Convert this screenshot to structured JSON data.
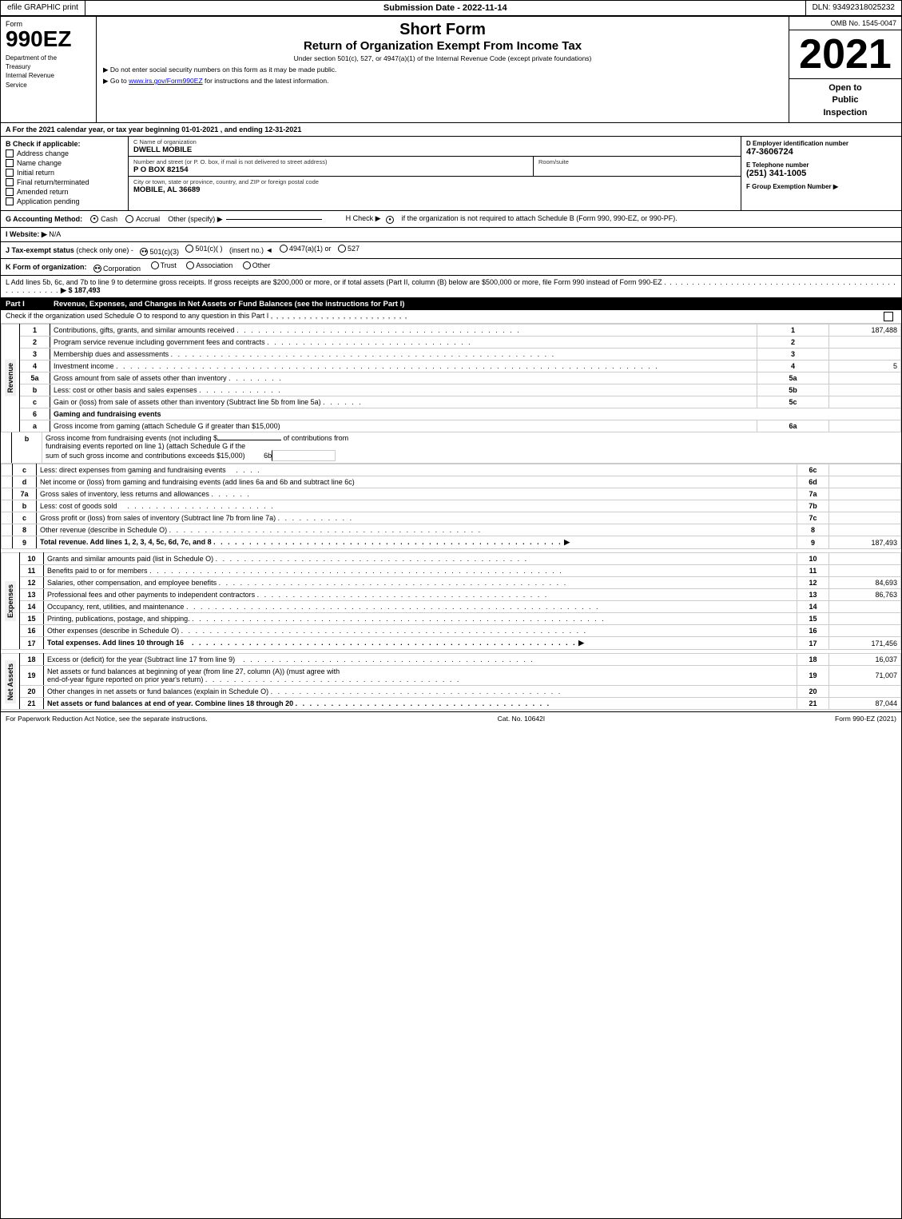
{
  "topbar": {
    "left": "efile GRAPHIC print",
    "mid": "Submission Date - 2022-11-14",
    "right": "DLN: 93492318025232"
  },
  "header": {
    "form_label": "Form",
    "form_number": "990EZ",
    "dept_line1": "Department of the",
    "dept_line2": "Treasury",
    "dept_line3": "Internal Revenue",
    "dept_line4": "Service",
    "title_main": "Short Form",
    "title_sub": "Return of Organization Exempt From Income Tax",
    "under_section": "Under section 501(c), 527, or 4947(a)(1) of the Internal Revenue Code (except private foundations)",
    "notice": "▶ Do not enter social security numbers on this form as it may be made public.",
    "goto": "▶ Go to www.irs.gov/Form990EZ for instructions and the latest information.",
    "omb": "OMB No. 1545-0047",
    "year": "2021",
    "open_public": "Open to Public Inspection"
  },
  "section_a": {
    "text": "A For the 2021 calendar year, or tax year beginning 01-01-2021 , and ending 12-31-2021"
  },
  "check_applicable": {
    "label": "B Check if applicable:",
    "items": [
      {
        "id": "address_change",
        "label": "Address change",
        "checked": false
      },
      {
        "id": "name_change",
        "label": "Name change",
        "checked": false
      },
      {
        "id": "initial_return",
        "label": "Initial return",
        "checked": false
      },
      {
        "id": "final_return",
        "label": "Final return/terminated",
        "checked": false
      },
      {
        "id": "amended_return",
        "label": "Amended return",
        "checked": false
      },
      {
        "id": "application_pending",
        "label": "Application pending",
        "checked": false
      }
    ]
  },
  "org": {
    "name_label": "C Name of organization",
    "name_value": "DWELL MOBILE",
    "address_label": "Number and street (or P. O. box, if mail is not delivered to street address)",
    "address_value": "P O BOX 82154",
    "room_label": "Room/suite",
    "room_value": "",
    "city_label": "City or town, state or province, country, and ZIP or foreign postal code",
    "city_value": "MOBILE, AL  36689"
  },
  "employer_id": {
    "label": "D Employer identification number",
    "value": "47-3606724"
  },
  "telephone": {
    "label": "E Telephone number",
    "value": "(251) 341-1005"
  },
  "group_exemption": {
    "label": "F Group Exemption Number",
    "arrow": "▶"
  },
  "accounting": {
    "label": "G Accounting Method:",
    "cash_label": "Cash",
    "cash_checked": true,
    "accrual_label": "Accrual",
    "accrual_checked": false,
    "other_label": "Other (specify) ▶",
    "other_value": "",
    "h_label": "H Check ▶",
    "h_checked": true,
    "h_text": "if the organization is not required to attach Schedule B (Form 990, 990-EZ, or 990-PF)."
  },
  "website": {
    "label": "I Website: ▶",
    "value": "N/A"
  },
  "tax_exempt": {
    "label": "J Tax-exempt status",
    "note": "(check only one) -",
    "options": [
      {
        "label": "501(c)(3)",
        "checked": true
      },
      {
        "label": "501(c)(  )",
        "checked": false
      },
      {
        "label": "(insert no.)",
        "checked": false
      },
      {
        "label": "4947(a)(1) or",
        "checked": false
      },
      {
        "label": "527",
        "checked": false
      }
    ]
  },
  "form_org": {
    "label": "K Form of organization:",
    "options": [
      {
        "label": "Corporation",
        "checked": true
      },
      {
        "label": "Trust",
        "checked": false
      },
      {
        "label": "Association",
        "checked": false
      },
      {
        "label": "Other",
        "checked": false
      }
    ]
  },
  "add_lines": {
    "label": "L Add lines 5b, 6c, and 7b to line 9 to determine gross receipts. If gross receipts are $200,000 or more, or if total assets (Part II, column (B) below are $500,000 or more, file Form 990 instead of Form 990-EZ",
    "dots": ". . . . . . . . . . . . . . . . . . . . . . . . . . . . . . . . . . . . . . . . . . . . . . . . . . . .",
    "arrow": "▶",
    "value": "$ 187,493"
  },
  "part1": {
    "header_left": "Part I",
    "header_right": "Revenue, Expenses, and Changes in Net Assets or Fund Balances (see the instructions for Part I)",
    "check_line": "Check if the organization used Schedule O to respond to any question in this Part I",
    "dots": ". . . . . . . . . . . . . . . . . . . . . . . . .",
    "rows": [
      {
        "num": "1",
        "desc": "Contributions, gifts, grants, and similar amounts received",
        "dots": ". . . . . . . . . . . . . . . . . . . . . . . . . . . . . . . . . . . . . . . .",
        "line": "1",
        "value": "187,488"
      },
      {
        "num": "2",
        "desc": "Program service revenue including government fees and contracts",
        "dots": ". . . . . . . . . . . . . . . . . . . . . . . . . . . . .",
        "line": "2",
        "value": ""
      },
      {
        "num": "3",
        "desc": "Membership dues and assessments",
        "dots": ". . . . . . . . . . . . . . . . . . . . . . . . . . . . . . . . . . . . . . . . . . . . . . . . . . . . . .",
        "line": "3",
        "value": ""
      },
      {
        "num": "4",
        "desc": "Investment income",
        "dots": ". . . . . . . . . . . . . . . . . . . . . . . . . . . . . . . . . . . . . . . . . . . . . . . . . . . . . . . . . . . . . . . . . . . . . . . . . . . .",
        "line": "4",
        "value": "5"
      },
      {
        "num": "5a",
        "desc": "Gross amount from sale of assets other than inventory",
        "dots": ". . . . . . . .",
        "line": "5a",
        "value": "",
        "sub": true
      },
      {
        "num": "b",
        "desc": "Less: cost or other basis and sales expenses",
        "dots": ". . . . . . . . . . . .",
        "line": "5b",
        "value": "",
        "sub": true
      },
      {
        "num": "c",
        "desc": "Gain or (loss) from sale of assets other than inventory (Subtract line 5b from line 5a)",
        "dots": ". . . . . .",
        "line": "5c",
        "value": "",
        "sub": true
      },
      {
        "num": "6",
        "desc": "Gaming and fundraising events",
        "dots": "",
        "line": "",
        "value": "",
        "header": true
      },
      {
        "num": "a",
        "desc": "Gross income from gaming (attach Schedule G if greater than $15,000)",
        "dots": "",
        "line": "6a",
        "value": "",
        "sub": true
      },
      {
        "num": "b",
        "desc": "Gross income from fundraising events (not including $",
        "dots": "",
        "line": "",
        "value": "",
        "sub": true,
        "special_b": true
      },
      {
        "num": "c",
        "desc": "Less: direct expenses from gaming and fundraising events",
        "dots": ". . . .",
        "line": "6c",
        "value": "",
        "sub": true
      },
      {
        "num": "d",
        "desc": "Net income or (loss) from gaming and fundraising events (add lines 6a and 6b and subtract line 6c)",
        "dots": "",
        "line": "6d",
        "value": "",
        "sub": true
      },
      {
        "num": "7a",
        "desc": "Gross sales of inventory, less returns and allowances",
        "dots": ". . . . . .",
        "line": "7a",
        "value": "",
        "sub": true
      },
      {
        "num": "b",
        "desc": "Less: cost of goods sold",
        "dots": ". . . . . . . . . . . . . . . . . . . . .",
        "line": "7b",
        "value": "",
        "sub": true
      },
      {
        "num": "c",
        "desc": "Gross profit or (loss) from sales of inventory (Subtract line 7b from line 7a)",
        "dots": ". . . . . . . . . . .",
        "line": "7c",
        "value": "",
        "sub": true
      },
      {
        "num": "8",
        "desc": "Other revenue (describe in Schedule O)",
        "dots": ". . . . . . . . . . . . . . . . . . . . . . . . . . . . . . . . . . . . . . . . . . . . .",
        "line": "8",
        "value": ""
      },
      {
        "num": "9",
        "desc": "Total revenue. Add lines 1, 2, 3, 4, 5c, 6d, 7c, and 8",
        "dots": ". . . . . . . . . . . . . . . . . . . . . . . . . . . . . . . . . . . . . . . . . . . . . . . . .",
        "line": "9",
        "value": "187,493",
        "arrow": true,
        "bold": true
      }
    ]
  },
  "expenses_rows": [
    {
      "num": "10",
      "desc": "Grants and similar amounts paid (list in Schedule O)",
      "dots": ". . . . . . . . . . . . . . . . . . . . . . . . . . . . . . . . . . . . . . . . . . . .",
      "line": "10",
      "value": ""
    },
    {
      "num": "11",
      "desc": "Benefits paid to or for members",
      "dots": ". . . . . . . . . . . . . . . . . . . . . . . . . . . . . . . . . . . . . . . . . . . . . . . . . . . . . . . . . .",
      "line": "11",
      "value": ""
    },
    {
      "num": "12",
      "desc": "Salaries, other compensation, and employee benefits",
      "dots": ". . . . . . . . . . . . . . . . . . . . . . . . . . . . . . . . . . . . . . . . . . . . . . . . .",
      "line": "12",
      "value": "84,693"
    },
    {
      "num": "13",
      "desc": "Professional fees and other payments to independent contractors",
      "dots": ". . . . . . . . . . . . . . . . . . . . . . . . . . . . . . . . . . . . . . . . .",
      "line": "13",
      "value": "86,763"
    },
    {
      "num": "14",
      "desc": "Occupancy, rent, utilities, and maintenance",
      "dots": ". . . . . . . . . . . . . . . . . . . . . . . . . . . . . . . . . . . . . . . . . . . . . . . . . . . . . . . . . .",
      "line": "14",
      "value": ""
    },
    {
      "num": "15",
      "desc": "Printing, publications, postage, and shipping.",
      "dots": ". . . . . . . . . . . . . . . . . . . . . . . . . . . . . . . . . . . . . . . . . . . . . . . . . . . . . . . . . .",
      "line": "15",
      "value": ""
    },
    {
      "num": "16",
      "desc": "Other expenses (describe in Schedule O)",
      "dots": ". . . . . . . . . . . . . . . . . . . . . . . . . . . . . . . . . . . . . . . . . . . . . . . . . . . . . . . . .",
      "line": "16",
      "value": ""
    },
    {
      "num": "17",
      "desc": "Total expenses. Add lines 10 through 16",
      "dots": ". . . . . . . . . . . . . . . . . . . . . . . . . . . . . . . . . . . . . . . . . . . . . . . . . . . . . .",
      "line": "17",
      "value": "171,456",
      "arrow": true,
      "bold": true
    }
  ],
  "net_assets_rows": [
    {
      "num": "18",
      "desc": "Excess or (deficit) for the year (Subtract line 17 from line 9)",
      "dots": ". . . . . . . . . . . . . . . . . . . . . . . . . . . . . . . . . . . . . . . . .",
      "line": "18",
      "value": "16,037"
    },
    {
      "num": "19",
      "desc": "Net assets or fund balances at beginning of year (from line 27, column (A)) (must agree with end-of-year figure reported on prior year's return)",
      "dots": ". . . . . . . . . . . . . . . . . . . . . . . . . . . . . . . . . . . .",
      "line": "19",
      "value": "71,007"
    },
    {
      "num": "20",
      "desc": "Other changes in net assets or fund balances (explain in Schedule O)",
      "dots": ". . . . . . . . . . . . . . . . . . . . . . . . . . . . . . . . . . . . . . . . .",
      "line": "20",
      "value": ""
    },
    {
      "num": "21",
      "desc": "Net assets or fund balances at end of year. Combine lines 18 through 20",
      "dots": ". . . . . . . . . . . . . . . . . . . . . . . . . . . . . . . . . . . .",
      "line": "21",
      "value": "87,044",
      "bold": true
    }
  ],
  "footer": {
    "paperwork": "For Paperwork Reduction Act Notice, see the separate instructions.",
    "cat": "Cat. No. 10642I",
    "form_ref": "Form 990-EZ (2021)"
  }
}
